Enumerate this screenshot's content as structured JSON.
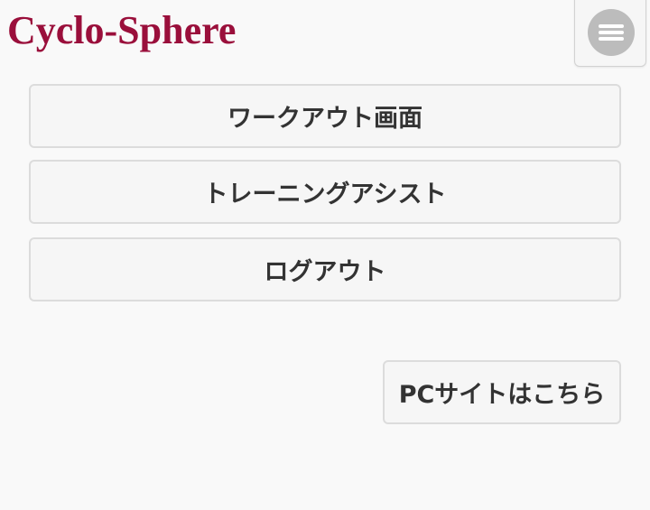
{
  "header": {
    "logo_text": "Cyclo-Sphere",
    "menu_icon": "hamburger-menu-icon"
  },
  "nav": {
    "items": [
      {
        "label": "ワークアウト画面"
      },
      {
        "label": "トレーニングアシスト"
      },
      {
        "label": "ログアウト"
      }
    ]
  },
  "footer": {
    "pc_site_label": "PCサイトはこちら"
  },
  "colors": {
    "logo": "#9a0f3b",
    "background": "#f9f9f9",
    "button_bg": "#f6f6f6",
    "button_border": "#dcdcdc",
    "menu_circle": "#bcbcbc"
  }
}
